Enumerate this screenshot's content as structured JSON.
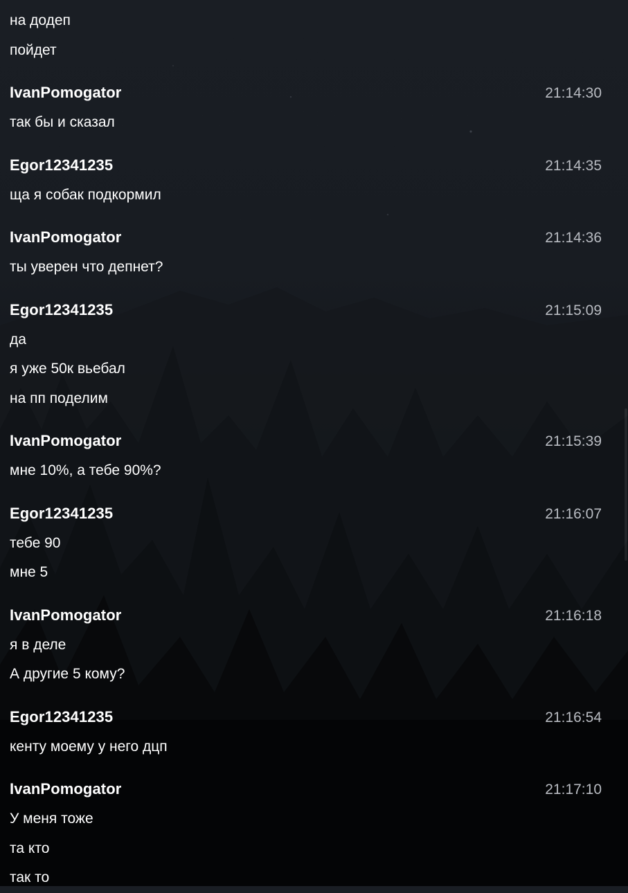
{
  "chat": {
    "lead_lines": [
      "на додеп",
      "пойдет"
    ],
    "messages": [
      {
        "author": "IvanPomogator",
        "time": "21:14:30",
        "lines": [
          "так бы и сказал"
        ]
      },
      {
        "author": "Egor12341235",
        "time": "21:14:35",
        "lines": [
          "ща я собак подкормил"
        ]
      },
      {
        "author": "IvanPomogator",
        "time": "21:14:36",
        "lines": [
          "ты уверен что депнет?"
        ]
      },
      {
        "author": "Egor12341235",
        "time": "21:15:09",
        "lines": [
          "да",
          "я уже 50к вьебал",
          "на пп поделим"
        ]
      },
      {
        "author": "IvanPomogator",
        "time": "21:15:39",
        "lines": [
          "мне 10%, а тебе 90%?"
        ]
      },
      {
        "author": "Egor12341235",
        "time": "21:16:07",
        "lines": [
          "тебе 90",
          "мне 5"
        ]
      },
      {
        "author": "IvanPomogator",
        "time": "21:16:18",
        "lines": [
          "я в деле",
          "А другие 5 кому?"
        ]
      },
      {
        "author": "Egor12341235",
        "time": "21:16:54",
        "lines": [
          "кенту моему у него дцп"
        ]
      },
      {
        "author": "IvanPomogator",
        "time": "21:17:10",
        "lines": [
          "У меня тоже",
          "та кто",
          "так то"
        ]
      }
    ]
  },
  "colors": {
    "background_top": "#1a1e24",
    "background_bottom": "#050608",
    "author_text": "#ffffff",
    "message_text": "#ffffff",
    "timestamp_text": "#b9bcc2"
  }
}
